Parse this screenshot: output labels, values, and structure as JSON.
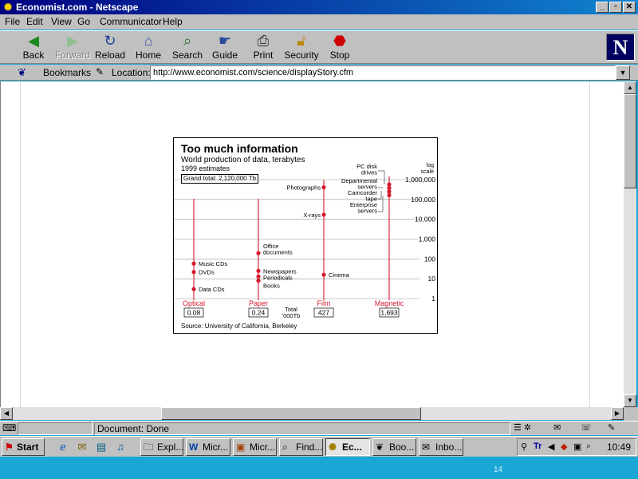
{
  "window": {
    "title": "Economist.com - Netscape"
  },
  "menu": [
    "File",
    "Edit",
    "View",
    "Go",
    "Communicator",
    "Help"
  ],
  "toolbar": [
    {
      "label": "Back",
      "icon": "back-arrow-icon",
      "disabled": false
    },
    {
      "label": "Forward",
      "icon": "forward-arrow-icon",
      "disabled": true
    },
    {
      "label": "Reload",
      "icon": "reload-icon",
      "disabled": false
    },
    {
      "label": "Home",
      "icon": "home-icon",
      "disabled": false
    },
    {
      "label": "Search",
      "icon": "search-icon",
      "disabled": false
    },
    {
      "label": "Guide",
      "icon": "guide-icon",
      "disabled": false
    },
    {
      "label": "Print",
      "icon": "printer-icon",
      "disabled": false
    },
    {
      "label": "Security",
      "icon": "lock-icon",
      "disabled": false
    },
    {
      "label": "Stop",
      "icon": "stop-icon",
      "disabled": false
    }
  ],
  "location": {
    "bookmarks_label": "Bookmarks",
    "label": "Location:",
    "url": "http://www.economist.com/science/displayStory.cfm"
  },
  "status": {
    "text": "Document: Done"
  },
  "taskbar": {
    "start_label": "Start",
    "tasks": [
      "Expl...",
      "Micr...",
      "Micr...",
      "Find...",
      "Ec...",
      "Boo...",
      "Inbo..."
    ],
    "active_index": 4,
    "clock": "10:49"
  },
  "slide_number": "14",
  "chart_data": {
    "type": "scatter",
    "title": "Too much information",
    "subtitle": "World production of data, terabytes",
    "subtitle2": "1999 estimates",
    "grand_total": "Grand total: 2,120,000 Tb",
    "y_scale_label": [
      "log",
      "scale"
    ],
    "yscale": "log",
    "ylim": [
      1,
      1000000
    ],
    "y_ticks": [
      "1,000,000",
      "100,000",
      "10,000",
      "1,000",
      "100",
      "10",
      "1"
    ],
    "total_label": [
      "Total",
      "'000Tb"
    ],
    "source": "Source: University of California, Berkeley",
    "color": "#d6192e",
    "series": [
      {
        "name": "Optical",
        "total": "0.08",
        "points": [
          {
            "label": "Music CDs",
            "value": 58
          },
          {
            "label": "DVDs",
            "value": 22
          },
          {
            "label": "Data CDs",
            "value": 3
          }
        ]
      },
      {
        "name": "Paper",
        "total": "0.24",
        "points": [
          {
            "label": "Office documents",
            "value": 195
          },
          {
            "label": "Newspapers",
            "value": 25
          },
          {
            "label": "Periodicals",
            "value": 13
          },
          {
            "label": "Books",
            "value": 8
          }
        ]
      },
      {
        "name": "Film",
        "total": "427",
        "points": [
          {
            "label": "Photographs",
            "value": 410000
          },
          {
            "label": "X-rays",
            "value": 17000
          },
          {
            "label": "Cinema",
            "value": 16
          }
        ]
      },
      {
        "name": "Magnetic",
        "total": "1,693",
        "points": [
          {
            "label": "PC disk drives",
            "value": 700000
          },
          {
            "label": "Departmental servers",
            "value": 500000
          },
          {
            "label": "Camcorder tape",
            "value": 300000
          },
          {
            "label": "Enterprise servers",
            "value": 170000
          }
        ]
      }
    ]
  }
}
